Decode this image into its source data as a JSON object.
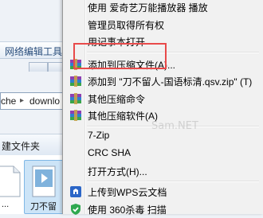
{
  "explorer": {
    "toolbar_text": "网络编辑工具",
    "address_segments": [
      "che",
      "downlo"
    ],
    "command_text": "建文件夹",
    "files": [
      {
        "label": "..."
      },
      {
        "label": "刀不留"
      }
    ]
  },
  "context_menu": {
    "items": [
      {
        "label": "使用 爱奇艺万能播放器 播放"
      },
      {
        "label": "管理员取得所有权"
      },
      {
        "label": "用记事本打开"
      },
      {
        "label": "添加到压缩文件(A)...",
        "icon": "winrar-archive-icon"
      },
      {
        "label": "添加到 \"刀不留人-国语标清.qsv.zip\" (T)",
        "icon": "winrar-archive-icon"
      },
      {
        "label": "其他压缩命令",
        "icon": "winrar-archive-icon"
      },
      {
        "label": "其他压缩软件(A)",
        "icon": "winrar-archive-icon"
      },
      {
        "label": "7-Zip"
      },
      {
        "label": "CRC SHA"
      },
      {
        "label": "打开方式(H)..."
      },
      {
        "label": "上传到WPS云文档",
        "icon": "wps-cloud-icon"
      },
      {
        "label": "使用 360杀毒 扫描",
        "icon": "360-antivirus-icon"
      }
    ]
  },
  "watermark": "Sam.NET",
  "colors": {
    "highlight_border": "#e84a4a",
    "menu_background": "#f1f1f1"
  }
}
